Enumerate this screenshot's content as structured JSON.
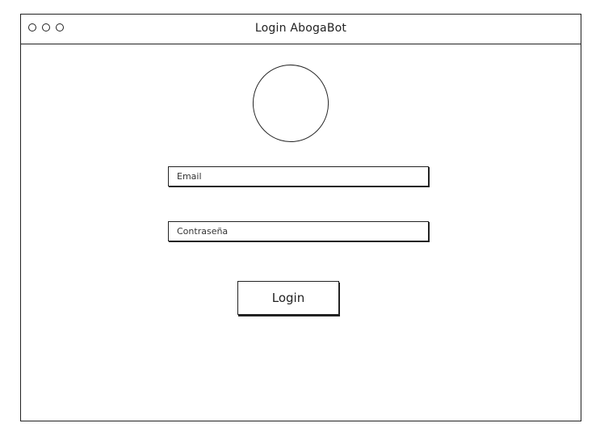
{
  "window": {
    "title": "Login AbogaBot"
  },
  "form": {
    "email_placeholder": "Email",
    "password_placeholder": "Contraseña",
    "login_label": "Login"
  }
}
